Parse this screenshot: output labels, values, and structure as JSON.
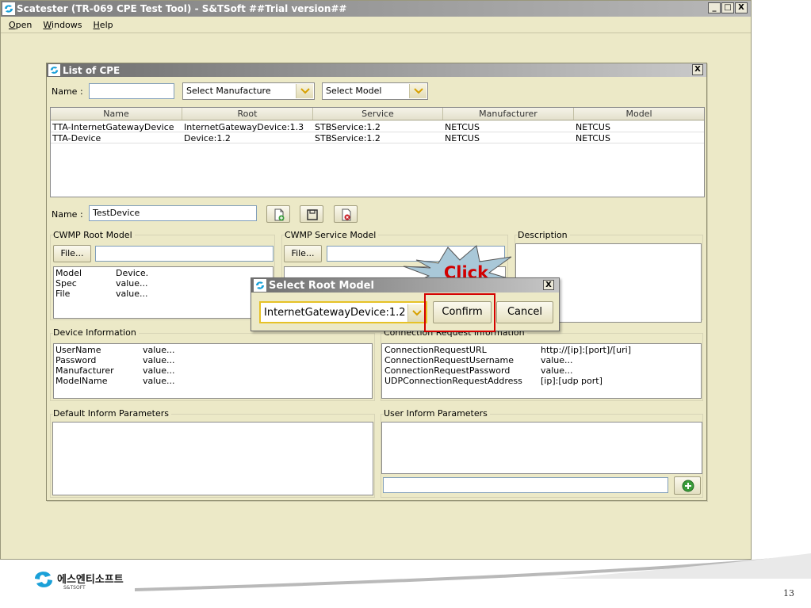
{
  "window": {
    "title": "Scatester (TR-069 CPE Test Tool) - S&TSoft ##Trial version##",
    "controls": [
      "_",
      "□",
      "X"
    ]
  },
  "menu": [
    {
      "label": "Open",
      "accel": "O"
    },
    {
      "label": "Windows",
      "accel": "W"
    },
    {
      "label": "Help",
      "accel": "H"
    }
  ],
  "cpe_list": {
    "title": "List of CPE",
    "close": "X",
    "name_label": "Name :",
    "name_value": "",
    "manufacture_select": "Select Manufacture",
    "model_select": "Select Model",
    "columns": [
      "Name",
      "Root",
      "Service",
      "Manufacturer",
      "Model"
    ],
    "rows": [
      [
        "TTA-InternetGatewayDevice",
        "InternetGatewayDevice:1.3",
        "STBService:1.2",
        "NETCUS",
        "NETCUS"
      ],
      [
        "TTA-Device",
        "Device:1.2",
        "STBService:1.2",
        "NETCUS",
        "NETCUS"
      ]
    ]
  },
  "device_form": {
    "name_label": "Name :",
    "name_value": "TestDevice",
    "root_model": {
      "title": "CWMP Root Model",
      "file_button": "File...",
      "file_value": "",
      "props": [
        {
          "key": "Model",
          "value": "Device."
        },
        {
          "key": "Spec",
          "value": "value..."
        },
        {
          "key": "File",
          "value": "value..."
        }
      ]
    },
    "service_model": {
      "title": "CWMP Service Model",
      "file_button": "File...",
      "file_value": ""
    },
    "description": {
      "title": "Description"
    },
    "device_info": {
      "title": "Device Information",
      "props": [
        {
          "key": "UserName",
          "value": "value..."
        },
        {
          "key": "Password",
          "value": "value..."
        },
        {
          "key": "Manufacturer",
          "value": "value..."
        },
        {
          "key": "ModelName",
          "value": "value..."
        }
      ]
    },
    "connection_info": {
      "title": "Connection Request Information",
      "props": [
        {
          "key": "ConnectionRequestURL",
          "value": "http://[ip]:[port]/[uri]"
        },
        {
          "key": "ConnectionRequestUsername",
          "value": "value..."
        },
        {
          "key": "ConnectionRequestPassword",
          "value": "value..."
        },
        {
          "key": "UDPConnectionRequestAddress",
          "value": "[ip]:[udp port]"
        }
      ]
    },
    "default_inform": {
      "title": "Default Inform Parameters"
    },
    "user_inform": {
      "title": "User Inform Parameters",
      "input_value": ""
    }
  },
  "popup": {
    "title": "Select Root Model",
    "close": "X",
    "selected": "InternetGatewayDevice:1.2",
    "confirm": "Confirm",
    "cancel": "Cancel"
  },
  "annotation": {
    "label": "Click",
    "color": "#d40000"
  },
  "footer": {
    "company": "에스엔티소프트",
    "company_sub": "S&TSOFT",
    "page_number": "13"
  }
}
